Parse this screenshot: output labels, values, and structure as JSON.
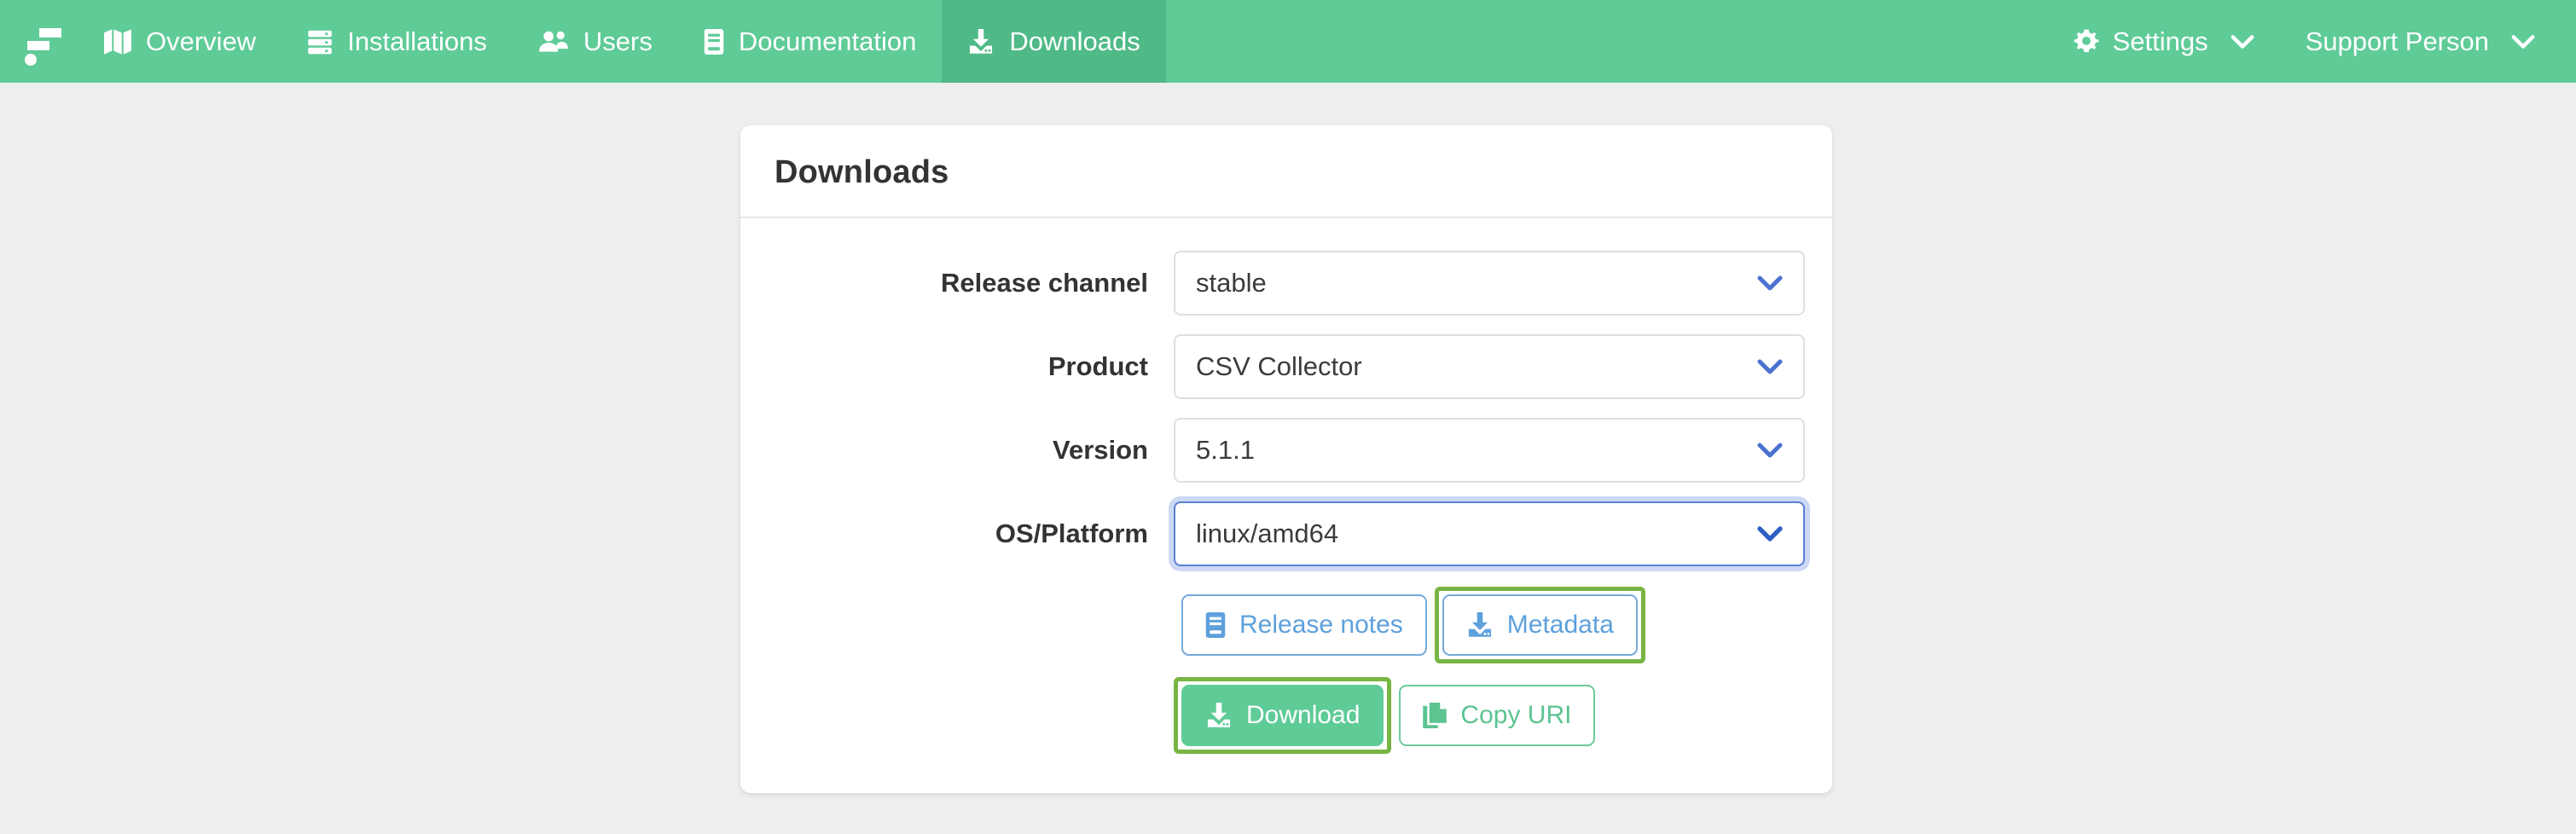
{
  "navbar": {
    "brand_icon": "logo-mark",
    "background_color": "#5fcb97",
    "active_color": "#4fba87",
    "items": [
      {
        "label": "Overview",
        "icon": "map-icon",
        "active": false
      },
      {
        "label": "Installations",
        "icon": "server-icon",
        "active": false
      },
      {
        "label": "Users",
        "icon": "users-icon",
        "active": false
      },
      {
        "label": "Documentation",
        "icon": "book-icon",
        "active": false
      },
      {
        "label": "Downloads",
        "icon": "download-icon",
        "active": true
      }
    ],
    "right_items": [
      {
        "label": "Settings",
        "icon": "gear-icon",
        "caret": "chevron-down-icon"
      },
      {
        "label": "Support Person",
        "icon": null,
        "caret": "chevron-down-icon"
      }
    ]
  },
  "card": {
    "title": "Downloads",
    "form": {
      "fields": [
        {
          "label": "Release channel",
          "value": "stable",
          "focused": false,
          "caret": "chevron-down-icon"
        },
        {
          "label": "Product",
          "value": "CSV Collector",
          "focused": false,
          "caret": "chevron-down-icon"
        },
        {
          "label": "Version",
          "value": "5.1.1",
          "focused": false,
          "caret": "chevron-down-icon"
        },
        {
          "label": "OS/Platform",
          "value": "linux/amd64",
          "focused": true,
          "caret": "chevron-down-icon"
        }
      ]
    },
    "actions_row_1": [
      {
        "label": "Release notes",
        "icon": "book-icon",
        "style": "outline-blue",
        "highlighted": false
      },
      {
        "label": "Metadata",
        "icon": "download-icon",
        "style": "outline-blue",
        "highlighted": true
      }
    ],
    "actions_row_2": [
      {
        "label": "Download",
        "icon": "download-icon",
        "style": "solid-green",
        "highlighted": true
      },
      {
        "label": "Copy URI",
        "icon": "copy-icon",
        "style": "outline-green",
        "highlighted": false
      }
    ]
  },
  "colors": {
    "brand_green": "#5fcb97",
    "brand_green_active": "#4fba87",
    "page_background": "#eeeeee",
    "highlight_border": "#78b542",
    "link_blue": "#5da0dc",
    "focus_blue": "#5b7fd4",
    "caret_blue": "#4c72d0",
    "text_dark": "#333333"
  }
}
